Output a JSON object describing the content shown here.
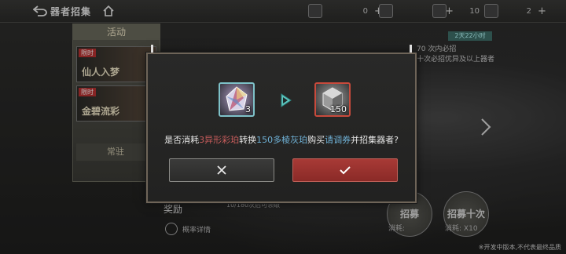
{
  "topbar": {
    "title": "器者招集",
    "resources": [
      {
        "icon": "envelope-ticket-icon",
        "value": "0"
      },
      {
        "icon": "summon-scroll-icon",
        "value": "0"
      },
      {
        "icon": "prism-shard-icon",
        "value": "10"
      },
      {
        "icon": "gem-icon",
        "value": "2"
      }
    ]
  },
  "sidebar": {
    "title": "活动",
    "cards": [
      {
        "tag": "限时",
        "name": "仙人入梦"
      },
      {
        "tag": "限时",
        "name": "金碧流彩"
      }
    ],
    "normal_label": "常驻"
  },
  "background": {
    "limit_badge": "2天22小时",
    "hint_line1": "70 次内必招",
    "hint_line2": "十次必招优异及以上器者",
    "reward_label": "奖励",
    "reward_progress": "10/180次后可领取",
    "prob_detail": "概率详情",
    "summon_one": "招募",
    "summon_ten": "招募十次",
    "cost_one": "消耗:",
    "cost_ten": "消耗:",
    "cost_ten_count": "X10",
    "footer_note": "※开发中版本,不代表最终品质"
  },
  "dialog": {
    "from_item": {
      "name": "异形彩珀",
      "count": "3",
      "icon": "iridescent-amber-icon",
      "frame_color": "#7ec1c8"
    },
    "to_item": {
      "name": "多棱灰珀",
      "count": "150",
      "icon": "grey-crystal-icon",
      "frame_color": "#c84a3c"
    },
    "message": {
      "p1": "是否消耗",
      "p2": "3异形彩珀",
      "p3": "转换",
      "p4": "150多棱灰珀",
      "p5": "购买",
      "p6": "请调券",
      "p7": "并招集器者?"
    },
    "cancel_icon": "close-icon",
    "confirm_icon": "check-icon"
  },
  "colors": {
    "accent_red": "#c85c5c",
    "accent_blue": "#6fb1d6",
    "confirm_bg": "#9b332f",
    "dialog_border": "#6e6458"
  }
}
